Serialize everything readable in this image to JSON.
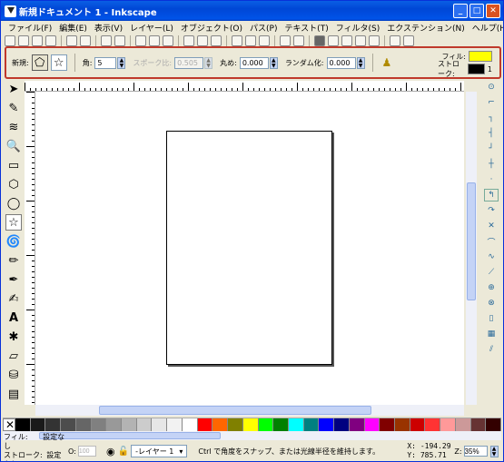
{
  "window": {
    "title": "新規ドキュメント 1 - Inkscape"
  },
  "menu": [
    "ファイル(F)",
    "編集(E)",
    "表示(V)",
    "レイヤー(L)",
    "オブジェクト(O)",
    "パス(P)",
    "テキスト(T)",
    "フィルタ(S)",
    "エクステンション(N)",
    "ヘルプ(H)"
  ],
  "controls": {
    "new_label": "新規:",
    "corners_label": "角:",
    "corners_value": "5",
    "spoke_label": "スポーク比:",
    "spoke_value": "0.505",
    "rounded_label": "丸め:",
    "rounded_value": "0.000",
    "random_label": "ランダム化:",
    "random_value": "0.000",
    "fill_label": "フィル:",
    "stroke_label": "ストローク:",
    "stroke_width": "1",
    "fill_color": "#ffff00",
    "stroke_color": "#000000"
  },
  "status": {
    "fill_label": "フィル:",
    "fill_value": "設定なし",
    "stroke_label": "ストローク:",
    "stroke_value": "設定なし",
    "opacity_label": "O:",
    "opacity_value": "100",
    "layer": "-レイヤー 1",
    "message": "Ctrl で角度をスナップ、または光線半径を維持します。",
    "x_label": "X:",
    "x_value": "-194.29",
    "y_label": "Y:",
    "y_value": "785.71",
    "zoom_label": "Z:",
    "zoom_value": "35%"
  },
  "palette": [
    "#000000",
    "#1a1a1a",
    "#333333",
    "#4d4d4d",
    "#666666",
    "#808080",
    "#999999",
    "#b3b3b3",
    "#cccccc",
    "#e6e6e6",
    "#f2f2f2",
    "#ffffff",
    "#ff0000",
    "#ff6600",
    "#808000",
    "#ffff00",
    "#00ff00",
    "#008000",
    "#00ffff",
    "#008080",
    "#0000ff",
    "#000080",
    "#800080",
    "#ff00ff",
    "#800000",
    "#993300",
    "#cc0000",
    "#ff3333",
    "#ff9999",
    "#cc9999",
    "#663333",
    "#330000"
  ]
}
